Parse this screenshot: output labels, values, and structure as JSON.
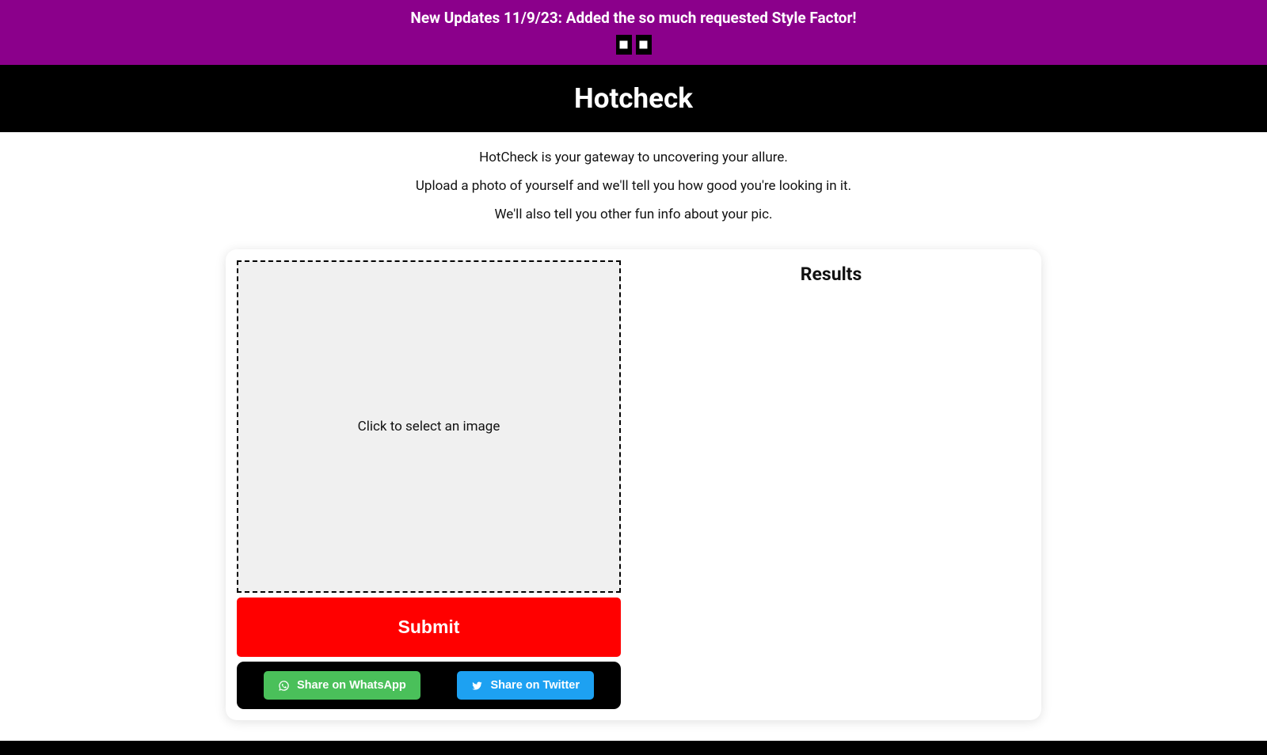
{
  "banner": {
    "text": "New Updates 11/9/23: Added the so much requested Style Factor!"
  },
  "header": {
    "title": "Hotcheck"
  },
  "intro": {
    "line1": "HotCheck is your gateway to uncovering your allure.",
    "line2": "Upload a photo of yourself and we'll tell you how good you're looking in it.",
    "line3": "We'll also tell you other fun info about your pic."
  },
  "dropzone": {
    "label": "Click to select an image"
  },
  "actions": {
    "submit_label": "Submit",
    "share_whatsapp_label": "Share on WhatsApp",
    "share_twitter_label": "Share on Twitter"
  },
  "results": {
    "title": "Results"
  }
}
